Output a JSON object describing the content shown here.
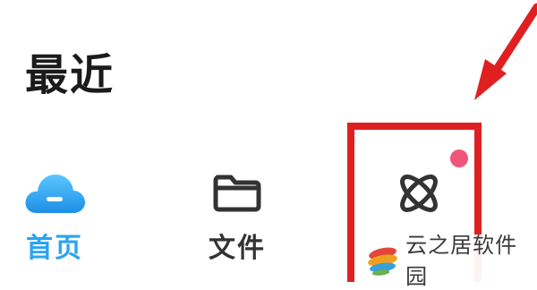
{
  "section": {
    "title": "最近"
  },
  "tabbar": {
    "items": [
      {
        "label": "首页",
        "icon": "cloud-home-icon",
        "active": true
      },
      {
        "label": "文件",
        "icon": "folder-icon",
        "active": false
      },
      {
        "label": "",
        "icon": "atom-discover-icon",
        "active": false,
        "badge_dot": true
      }
    ]
  },
  "annotation": {
    "highlight_color": "#e02020"
  },
  "watermark": {
    "text": "云之居软件园",
    "logo": "swirl-logo-icon"
  },
  "colors": {
    "accent": "#2aa4f0",
    "badge": "#f0567a"
  }
}
